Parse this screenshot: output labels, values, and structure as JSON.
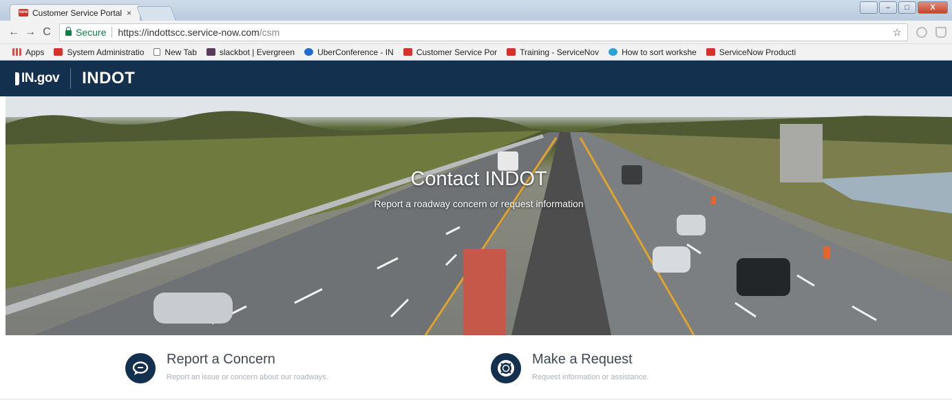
{
  "browser": {
    "tab_title": "Customer Service Portal",
    "tab_close": "×",
    "url_secure_label": "Secure",
    "url_host": "https://indottscc.service-now.com",
    "url_path": "/csm",
    "nav": {
      "back": "←",
      "forward": "→",
      "reload": "C"
    },
    "star": "☆",
    "window_controls": {
      "minimize": "–",
      "maximize": "□",
      "close": "X"
    }
  },
  "bookmarks": [
    {
      "label": "Apps",
      "icon": "apps-icon"
    },
    {
      "label": "System Administratio",
      "icon": "servicenow-icon"
    },
    {
      "label": "New Tab",
      "icon": "page-icon"
    },
    {
      "label": "slackbot | Evergreen",
      "icon": "slack-icon"
    },
    {
      "label": "UberConference - IN",
      "icon": "uberconference-icon"
    },
    {
      "label": "Customer Service Por",
      "icon": "servicenow-icon"
    },
    {
      "label": "Training - ServiceNov",
      "icon": "servicenow-icon"
    },
    {
      "label": "How to sort workshe",
      "icon": "sheet-icon"
    },
    {
      "label": "ServiceNow Producti",
      "icon": "servicenow-icon"
    }
  ],
  "header": {
    "ingov_logo": "IN.gov",
    "indot_logo": "INDOT"
  },
  "hero": {
    "title": "Contact INDOT",
    "subtitle": "Report a roadway concern or request information"
  },
  "actions": {
    "report": {
      "title": "Report a Concern",
      "description": "Report an issue or concern about our roadways.",
      "icon": "chat-bubble-icon"
    },
    "request": {
      "title": "Make a Request",
      "description": "Request information or assistance.",
      "icon": "lifebuoy-icon"
    }
  },
  "colors": {
    "header_bg": "#14304f",
    "secure_green": "#0b8043",
    "icon_circle": "#14304f"
  }
}
